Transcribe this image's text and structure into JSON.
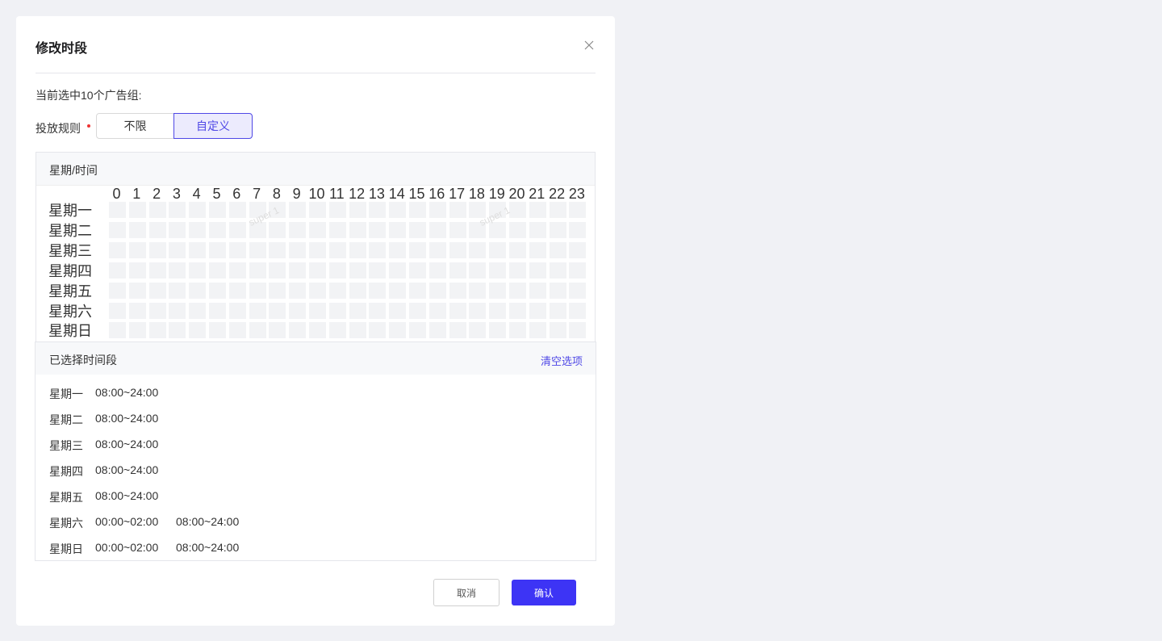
{
  "dialog": {
    "title": "修改时段",
    "selected_count_text": "当前选中10个广告组:",
    "rule_label": "投放规则",
    "rule_options": [
      "不限",
      "自定义"
    ],
    "rule_selected": "自定义"
  },
  "grid": {
    "header_label": "星期/时间",
    "hours": [
      "0",
      "1",
      "2",
      "3",
      "4",
      "5",
      "6",
      "7",
      "8",
      "9",
      "10",
      "11",
      "12",
      "13",
      "14",
      "15",
      "16",
      "17",
      "18",
      "19",
      "20",
      "21",
      "22",
      "23"
    ],
    "days": [
      "星期一",
      "星期二",
      "星期三",
      "星期四",
      "星期五",
      "星期六",
      "星期日"
    ],
    "watermarks": [
      "super 1",
      "super 1"
    ]
  },
  "selection": {
    "title": "已选择时间段",
    "clear_label": "清空选项",
    "rows": [
      {
        "day": "星期一",
        "ranges": [
          "08:00~24:00"
        ]
      },
      {
        "day": "星期二",
        "ranges": [
          "08:00~24:00"
        ]
      },
      {
        "day": "星期三",
        "ranges": [
          "08:00~24:00"
        ]
      },
      {
        "day": "星期四",
        "ranges": [
          "08:00~24:00"
        ]
      },
      {
        "day": "星期五",
        "ranges": [
          "08:00~24:00"
        ]
      },
      {
        "day": "星期六",
        "ranges": [
          "00:00~02:00",
          "08:00~24:00"
        ]
      },
      {
        "day": "星期日",
        "ranges": [
          "00:00~02:00",
          "08:00~24:00"
        ]
      }
    ]
  },
  "footer": {
    "cancel_label": "取消",
    "confirm_label": "确认"
  },
  "colors": {
    "accent": "#3d34f5",
    "required": "#e33333",
    "cell": "#f2f3f5"
  },
  "icons": {
    "close": "close-icon"
  }
}
